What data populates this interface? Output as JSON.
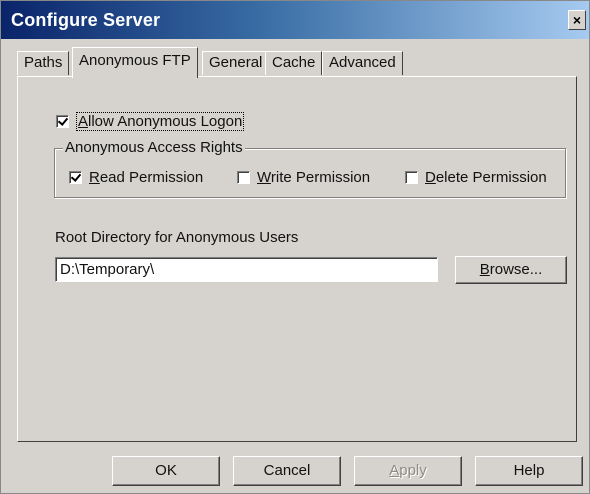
{
  "window": {
    "title": "Configure Server",
    "close_glyph": "×",
    "icon_close": "close-icon"
  },
  "tabs": [
    {
      "label": "Paths",
      "active": false
    },
    {
      "label": "Anonymous FTP",
      "active": true
    },
    {
      "label": "General",
      "active": false
    },
    {
      "label": "Cache",
      "active": false
    },
    {
      "label": "Advanced",
      "active": false
    }
  ],
  "panel": {
    "allow_anonymous": {
      "label_first": "A",
      "label_rest": "llow Anonymous Logon",
      "checked": true
    },
    "access_rights": {
      "title": "Anonymous Access Rights",
      "read": {
        "label_first": "R",
        "label_rest": "ead Permission",
        "checked": true
      },
      "write": {
        "label_first": "W",
        "label_rest": "rite Permission",
        "checked": false
      },
      "delete": {
        "label_first": "D",
        "label_rest": "elete Permission",
        "checked": false
      }
    },
    "root_dir": {
      "label": "Root Directory for Anonymous Users",
      "value": "D:\\Temporary\\",
      "browse_label_first": "B",
      "browse_label_rest": "rowse..."
    }
  },
  "buttons": {
    "ok": "OK",
    "cancel": "Cancel",
    "apply_first": "A",
    "apply_rest": "pply",
    "apply_enabled": false,
    "help": "Help"
  },
  "colors": {
    "dialog_face": "#d6d3ce",
    "titlebar_start": "#0a246a",
    "titlebar_end": "#a6caf0",
    "disabled_text": "#8e8b86"
  }
}
